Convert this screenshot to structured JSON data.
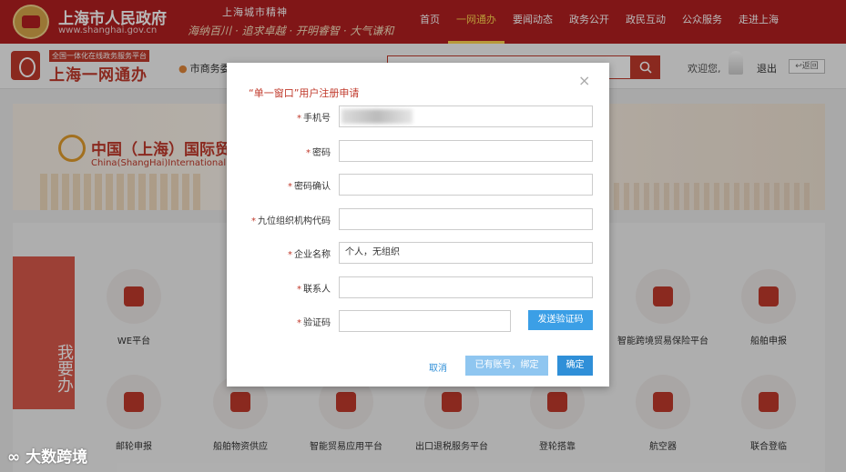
{
  "header": {
    "title": "上海市人民政府",
    "url": "www.shanghai.gov.cn",
    "slogan_top": "上海城市精神",
    "slogan_bottom": "海纳百川 · 追求卓越 · 开明睿智 · 大气谦和",
    "nav": [
      "首页",
      "一网通办",
      "要闻动态",
      "政务公开",
      "政民互动",
      "公众服务",
      "走进上海"
    ],
    "active_nav": "一网通办"
  },
  "subbar": {
    "platform_small": "全国一体化在线政务服务平台",
    "platform_name": "上海一网通办",
    "location": "市商务委",
    "welcome": "欢迎您,",
    "logout": "退出",
    "back": "返回"
  },
  "banner": {
    "title": "中国（上海）国际贸",
    "subtitle": "China(ShangHai)International"
  },
  "sidebar": {
    "label": "我要办"
  },
  "services": {
    "row1": [
      "WE平台",
      "",
      "",
      "",
      "",
      "智能跨境贸易保险平台",
      "船舶申报"
    ],
    "row2": [
      "邮轮申报",
      "船舶物资供应",
      "智能贸易应用平台",
      "出口退税服务平台",
      "登轮搭靠",
      "航空器",
      "联合登临"
    ]
  },
  "modal": {
    "title": "“单一窗口”用户注册申请",
    "close": "×",
    "fields": [
      {
        "label": "手机号",
        "value": ""
      },
      {
        "label": "密码",
        "value": ""
      },
      {
        "label": "密码确认",
        "value": ""
      },
      {
        "label": "九位组织机构代码",
        "value": ""
      },
      {
        "label": "企业名称",
        "value": "个人，无组织"
      },
      {
        "label": "联系人",
        "value": ""
      },
      {
        "label": "验证码",
        "value": ""
      }
    ],
    "send_code": "发送验证码",
    "cancel": "取消",
    "bind": "已有账号，绑定",
    "confirm": "确定"
  },
  "watermark": "大数跨境"
}
